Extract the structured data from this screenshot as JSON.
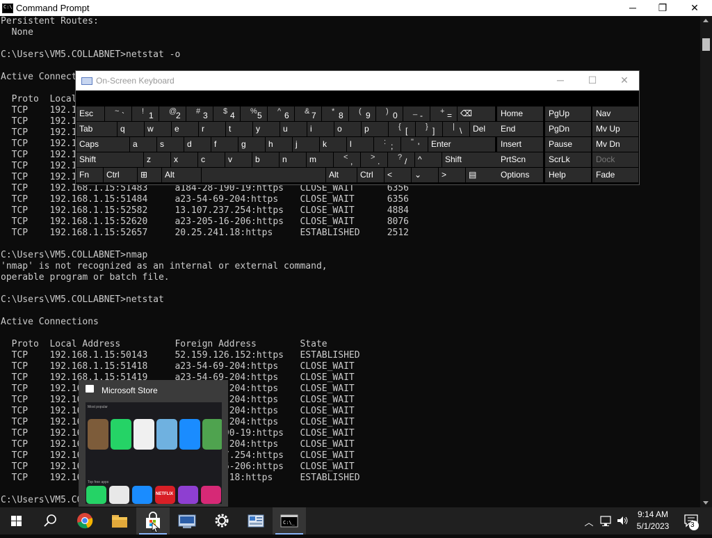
{
  "cmd": {
    "title": "Command Prompt",
    "minimize_glyph": "─",
    "maximize_glyph": "❐",
    "close_glyph": "✕",
    "lines": [
      "Persistent Routes:",
      "  None",
      "",
      "C:\\Users\\VM5.COLLABNET>netstat -o",
      "",
      "Active Connections",
      "",
      "  Proto  Local Address          Foreign Address        State           PID",
      "  TCP    192.168.1.15:50143     52.159.126.152:https   ESTABLISHED     3368",
      "  TCP    192.168.1.15:51418     a23-54-69-204:https    CLOSE_WAIT      6356",
      "  TCP    192.168.1.15:51419     a23-54-69-204:https    CLOSE_WAIT      6356",
      "  TCP    192.168.1.15:51420     a23-54-69-204:https    CLOSE_WAIT      6356",
      "  TCP    192.168.1.15:51447     a23-54-69-204:https    CLOSE_WAIT      6356",
      "  TCP    192.168.1.15:51448     a23-54-69-204:https    CLOSE_WAIT      6356",
      "  TCP    192.168.1.15:51449     a23-54-69-204:https    CLOSE_WAIT      6356",
      "  TCP    192.168.1.15:51483     a184-28-190-19:https   CLOSE_WAIT      6356",
      "  TCP    192.168.1.15:51484     a23-54-69-204:https    CLOSE_WAIT      6356",
      "  TCP    192.168.1.15:52582     13.107.237.254:https   CLOSE_WAIT      4884",
      "  TCP    192.168.1.15:52620     a23-205-16-206:https   CLOSE_WAIT      8076",
      "  TCP    192.168.1.15:52657     20.25.241.18:https     ESTABLISHED     2512",
      "",
      "C:\\Users\\VM5.COLLABNET>nmap",
      "'nmap' is not recognized as an internal or external command,",
      "operable program or batch file.",
      "",
      "C:\\Users\\VM5.COLLABNET>netstat",
      "",
      "Active Connections",
      "",
      "  Proto  Local Address          Foreign Address        State",
      "  TCP    192.168.1.15:50143     52.159.126.152:https   ESTABLISHED",
      "  TCP    192.168.1.15:51418     a23-54-69-204:https    CLOSE_WAIT",
      "  TCP    192.168.1.15:51419     a23-54-69-204:https    CLOSE_WAIT",
      "  TCP    192.168.1.15:51420     a23-54-69-204:https    CLOSE_WAIT",
      "  TCP    192.168.1.15:51447     a23-54-69-204:https    CLOSE_WAIT",
      "  TCP    192.168.1.15:51448     a23-54-69-204:https    CLOSE_WAIT",
      "  TCP    192.168.1.15:51449     a23-54-69-204:https    CLOSE_WAIT",
      "  TCP    192.168.1.15:51483     a184-28-190-19:https   CLOSE_WAIT",
      "  TCP    192.168.1.15:51484     a23-54-69-204:https    CLOSE_WAIT",
      "  TCP    192.168.1.15:52582     13.107.237.254:https   CLOSE_WAIT",
      "  TCP    192.168.1.15:52620     a23-205-16-206:https   CLOSE_WAIT",
      "  TCP    192.168.1.15:52657     20.25.241.18:https     ESTABLISHED",
      "",
      "C:\\Users\\VM5.COLLABNET>"
    ]
  },
  "osk": {
    "title": "On-Screen Keyboard",
    "minimize_glyph": "─",
    "maximize_glyph": "☐",
    "close_glyph": "✕",
    "rows": [
      [
        {
          "label": "Esc"
        },
        {
          "up": "~",
          "lo": "`"
        },
        {
          "up": "!",
          "lo": "1"
        },
        {
          "up": "@",
          "lo": "2"
        },
        {
          "up": "#",
          "lo": "3"
        },
        {
          "up": "$",
          "lo": "4"
        },
        {
          "up": "%",
          "lo": "5"
        },
        {
          "up": "^",
          "lo": "6"
        },
        {
          "up": "&",
          "lo": "7"
        },
        {
          "up": "*",
          "lo": "8"
        },
        {
          "up": "(",
          "lo": "9"
        },
        {
          "up": ")",
          "lo": "0"
        },
        {
          "up": "_",
          "lo": "-"
        },
        {
          "up": "+",
          "lo": "="
        },
        {
          "label": "⌫"
        }
      ],
      [
        {
          "label": "Tab"
        },
        {
          "label": "q"
        },
        {
          "label": "w"
        },
        {
          "label": "e"
        },
        {
          "label": "r"
        },
        {
          "label": "t"
        },
        {
          "label": "y"
        },
        {
          "label": "u"
        },
        {
          "label": "i"
        },
        {
          "label": "o"
        },
        {
          "label": "p"
        },
        {
          "up": "{",
          "lo": "["
        },
        {
          "up": "}",
          "lo": "]"
        },
        {
          "up": "|",
          "lo": "\\"
        },
        {
          "label": "Del"
        }
      ],
      [
        {
          "label": "Caps"
        },
        {
          "label": "a"
        },
        {
          "label": "s"
        },
        {
          "label": "d"
        },
        {
          "label": "f"
        },
        {
          "label": "g"
        },
        {
          "label": "h"
        },
        {
          "label": "j"
        },
        {
          "label": "k"
        },
        {
          "label": "l"
        },
        {
          "up": ":",
          "lo": ";"
        },
        {
          "up": "\"",
          "lo": "'"
        },
        {
          "label": "Enter"
        }
      ],
      [
        {
          "label": "Shift"
        },
        {
          "label": "z"
        },
        {
          "label": "x"
        },
        {
          "label": "c"
        },
        {
          "label": "v"
        },
        {
          "label": "b"
        },
        {
          "label": "n"
        },
        {
          "label": "m"
        },
        {
          "up": "<",
          "lo": ","
        },
        {
          "up": ">",
          "lo": "."
        },
        {
          "up": "?",
          "lo": "/"
        },
        {
          "label": "^"
        },
        {
          "label": "Shift"
        }
      ],
      [
        {
          "label": "Fn"
        },
        {
          "label": "Ctrl"
        },
        {
          "label": "⊞"
        },
        {
          "label": "Alt"
        },
        {
          "label": ""
        },
        {
          "label": "Alt"
        },
        {
          "label": "Ctrl"
        },
        {
          "label": "<"
        },
        {
          "label": "⌄"
        },
        {
          "label": ">"
        },
        {
          "label": "▤"
        }
      ]
    ],
    "side": [
      [
        "Home",
        "PgUp",
        "Nav"
      ],
      [
        "End",
        "PgDn",
        "Mv Up"
      ],
      [
        "Insert",
        "Pause",
        "Mv Dn"
      ],
      [
        "PrtScn",
        "ScrLk",
        "Dock"
      ],
      [
        "Options",
        "Help",
        "Fade"
      ]
    ],
    "dimmed_key": "Dock"
  },
  "store_preview": {
    "title": "Microsoft Store",
    "section_popular": "Most popular",
    "section_free": "Top free apps",
    "tiles_row1": [
      "#7d5c3a",
      "#25d366",
      "#f0f0f0",
      "#6fb1e0",
      "#1a8cff",
      "#4fa34f",
      "#9c3fb5"
    ],
    "tiles_row2": [
      "#25d366",
      "#e8e8e8",
      "#1a8cff",
      "#d81f26",
      "#8e3fd1",
      "#d62976"
    ],
    "netflix_label": "NETFLIX"
  },
  "taskbar": {
    "apps": [
      {
        "name": "start-button",
        "glyph": "⊞"
      },
      {
        "name": "search-icon",
        "glyph": "⚲"
      },
      {
        "name": "chrome-icon",
        "glyph": ""
      },
      {
        "name": "file-explorer-icon",
        "glyph": ""
      },
      {
        "name": "microsoft-store-icon",
        "glyph": ""
      },
      {
        "name": "remote-desktop-icon",
        "glyph": ""
      },
      {
        "name": "settings-icon",
        "glyph": "⚙"
      },
      {
        "name": "control-panel-icon",
        "glyph": ""
      },
      {
        "name": "command-prompt-icon",
        "glyph": ""
      }
    ],
    "time": "9:14 AM",
    "date": "5/1/2023",
    "notification_count": "3",
    "tray_chevron": "︿",
    "volume_glyph": "🔈"
  }
}
